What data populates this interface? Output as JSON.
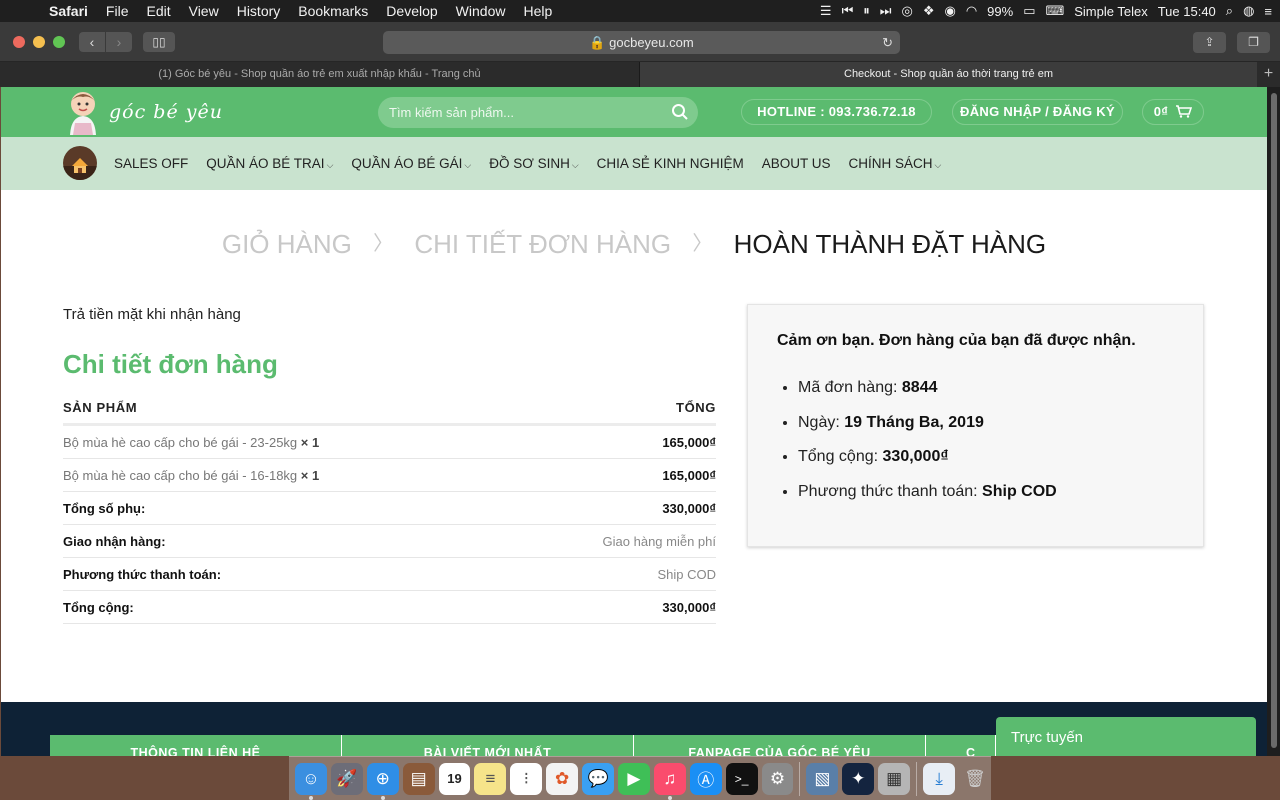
{
  "menubar": {
    "apple": "",
    "items": [
      "Safari",
      "File",
      "Edit",
      "View",
      "History",
      "Bookmarks",
      "Develop",
      "Window",
      "Help"
    ],
    "battery": "99%",
    "input_source": "Simple Telex",
    "clock": "Tue 15:40"
  },
  "browser": {
    "url": "gocbeyeu.com",
    "tabs": [
      {
        "title": "(1) Góc bé yêu - Shop quần áo trẻ em xuất nhập khẩu - Trang chủ",
        "active": false
      },
      {
        "title": "Checkout - Shop quần áo thời trang trẻ em",
        "active": true
      }
    ],
    "new_tab": "+"
  },
  "header": {
    "logo_text": "góc bé yêu",
    "search_placeholder": "Tìm kiếm sản phẩm...",
    "hotline": "HOTLINE : 093.736.72.18",
    "login": "ĐĂNG NHẬP / ĐĂNG KÝ",
    "cart": "0₫",
    "brand_color": "#5bbb6f"
  },
  "nav": {
    "items": [
      {
        "label": "SALES OFF",
        "dropdown": ""
      },
      {
        "label": "QUẦN ÁO BÉ TRAI",
        "dropdown": "⌵"
      },
      {
        "label": "QUẦN ÁO BÉ GÁI",
        "dropdown": "⌵"
      },
      {
        "label": "ĐỒ SƠ SINH",
        "dropdown": "⌵"
      },
      {
        "label": "CHIA SẺ KINH NGHIỆM",
        "dropdown": ""
      },
      {
        "label": "ABOUT US",
        "dropdown": ""
      },
      {
        "label": "CHÍNH SÁCH",
        "dropdown": "⌵"
      }
    ]
  },
  "steps": {
    "cart": "GIỎ HÀNG",
    "details": "CHI TIẾT ĐƠN HÀNG",
    "complete": "HOÀN THÀNH ĐẶT HÀNG",
    "separator": "〉"
  },
  "order": {
    "payment_note": "Trả tiền mặt khi nhận hàng",
    "heading": "Chi tiết đơn hàng",
    "col_product": "SẢN PHẨM",
    "col_total": "TỔNG",
    "items": [
      {
        "name": "Bộ mùa hè cao cấp cho bé gái - 23-25kg",
        "qty": "× 1",
        "total": "165,000₫"
      },
      {
        "name": "Bộ mùa hè cao cấp cho bé gái - 16-18kg",
        "qty": "× 1",
        "total": "165,000₫"
      }
    ],
    "subtotal_label": "Tổng số phụ:",
    "subtotal": "330,000₫",
    "shipping_label": "Giao nhận hàng:",
    "shipping": "Giao hàng miễn phí",
    "method_label": "Phương thức thanh toán:",
    "method": "Ship COD",
    "grand_label": "Tổng cộng:",
    "grand_total": "330,000₫"
  },
  "thanks": {
    "title": "Cảm ơn bạn. Đơn hàng của bạn đã được nhận.",
    "order_no_label": "Mã đơn hàng:",
    "order_no": "8844",
    "date_label": "Ngày:",
    "date": "19 Tháng Ba, 2019",
    "total_label": "Tổng cộng:",
    "total": "330,000₫",
    "method_label": "Phương thức thanh toán:",
    "method": "Ship COD"
  },
  "footer": {
    "tabs": [
      "THÔNG TIN LIÊN HỆ",
      "BÀI VIẾT MỚI NHẤT",
      "FANPAGE CỦA GÓC BÉ YÊU",
      "C"
    ],
    "online_chat": "Trực tuyến"
  },
  "dock": {
    "calendar_day": "19"
  }
}
